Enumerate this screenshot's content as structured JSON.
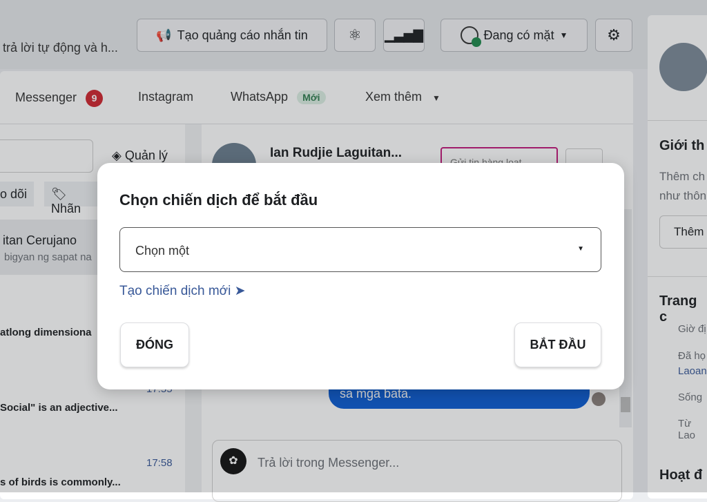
{
  "header": {
    "subtitle": "trả lời tự động và h...",
    "ad_button": "Tạo quảng cáo nhắn tin",
    "status": "Đang có mặt"
  },
  "tabs": [
    {
      "label": "Messenger",
      "badge": "9"
    },
    {
      "label": "Instagram"
    },
    {
      "label": "WhatsApp",
      "badge": "Mới"
    },
    {
      "label": "Xem thêm"
    }
  ],
  "inbox": {
    "manage": "Quản lý",
    "filter_follow": "o dõi",
    "filter_label": "Nhãn",
    "items": [
      {
        "name": "itan Cerujano",
        "preview": "bigyan ng sapat na"
      },
      {
        "preview": "atlong dimensiona"
      },
      {
        "time": "17:55",
        "preview": "Social\" is an adjective..."
      },
      {
        "time": "17:58",
        "preview": "s of birds is commonly..."
      }
    ]
  },
  "chat": {
    "contact": "Ian Rudjie Laguitan...",
    "action": "Gửi tin hàng loạt",
    "bubble": "sa mga bata.",
    "reply_placeholder": "Trả lời trong Messenger..."
  },
  "right": {
    "intro_title": "Giới th",
    "intro_text1": "Thêm ch",
    "intro_text2": "như thôn",
    "add": "Thêm",
    "page_title": "Trang c",
    "rows": [
      "Giờ đị",
      "Đã họ",
      "Laoan",
      "Sống",
      "Từ Lao"
    ],
    "activity": "Hoạt đ"
  },
  "modal": {
    "title": "Chọn chiến dịch để bắt đầu",
    "select_value": "Chọn một",
    "create_link": "Tạo chiến dịch mới ➤",
    "close": "ĐÓNG",
    "start": "BẮT ĐẦU"
  },
  "colors": {
    "badge": "#d0262f",
    "new_badge": "#2e7d4f",
    "link": "#385898",
    "bubble": "#0b5bd3",
    "online": "#1e8a4c",
    "highlight_border": "#c2187a"
  }
}
